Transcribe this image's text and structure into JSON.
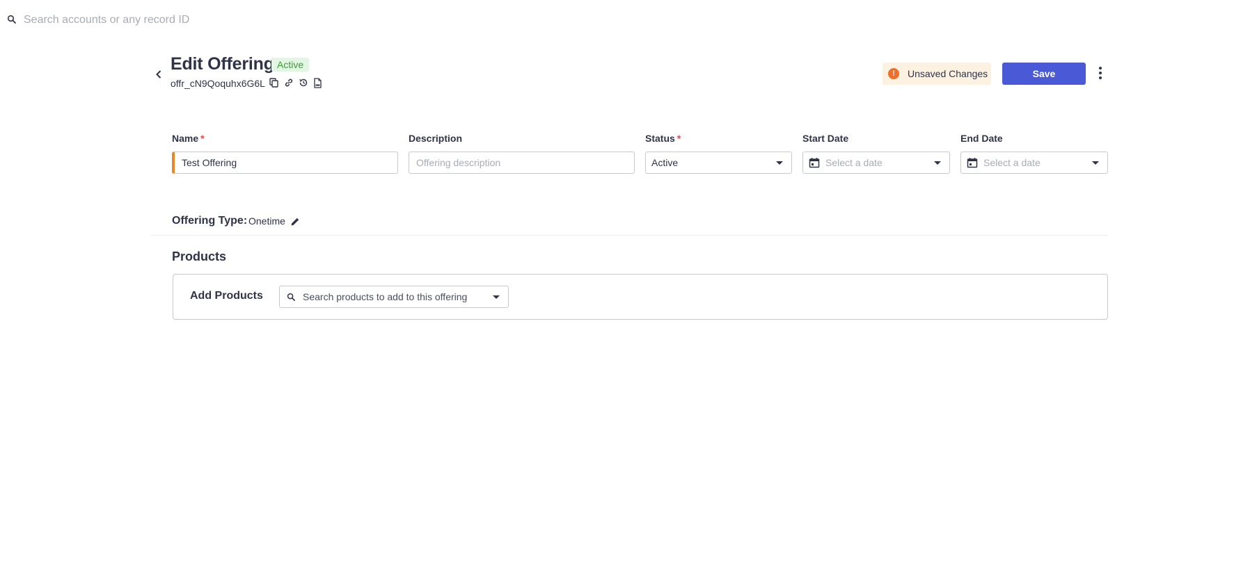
{
  "top_search": {
    "placeholder": "Search accounts or any record ID"
  },
  "header": {
    "title": "Edit Offering",
    "status_badge": "Active",
    "record_id": "offr_cN9Qoquhx6G6L",
    "unsaved_label": "Unsaved Changes",
    "unsaved_icon": "!",
    "save_label": "Save"
  },
  "form": {
    "name": {
      "label": "Name",
      "required": "*",
      "value": "Test Offering"
    },
    "description": {
      "label": "Description",
      "placeholder": "Offering description"
    },
    "status": {
      "label": "Status",
      "required": "*",
      "value": "Active"
    },
    "start_date": {
      "label": "Start Date",
      "placeholder": "Select a date"
    },
    "end_date": {
      "label": "End Date",
      "placeholder": "Select a date"
    }
  },
  "offering_type": {
    "label": "Offering Type:",
    "value": "Onetime"
  },
  "products": {
    "title": "Products",
    "add_label": "Add Products",
    "search_placeholder": "Search products to add to this offering"
  },
  "colors": {
    "primary": "#4a5ad6",
    "badge_bg": "#e3f6e3",
    "badge_text": "#3d9c3d",
    "warning": "#ef6f2b",
    "warning_bg": "#fdf1e2",
    "required": "#e04a4a",
    "name_accent": "#e8862a"
  }
}
